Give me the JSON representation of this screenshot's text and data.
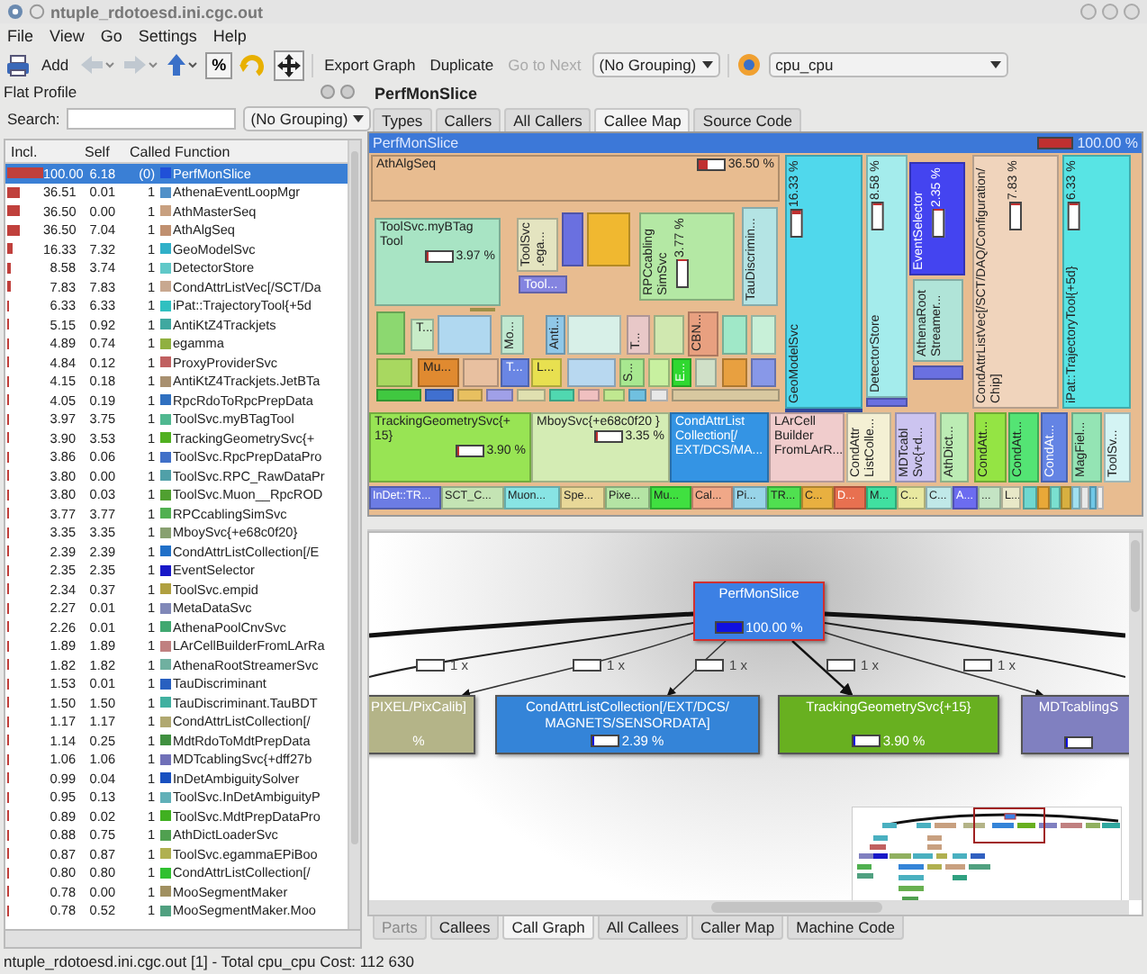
{
  "window": {
    "title": "ntuple_rdotoesd.ini.cgc.out"
  },
  "menu": [
    "File",
    "View",
    "Go",
    "Settings",
    "Help"
  ],
  "toolbar": {
    "add": "Add",
    "percent_toggle": {
      "label": "%",
      "checked": true
    },
    "move_toggle": {
      "checked": true
    },
    "export": "Export Graph",
    "duplicate": "Duplicate",
    "go_next": {
      "label": "Go to Next",
      "disabled": true
    },
    "grouping": "(No Grouping)",
    "event_type": "cpu_cpu"
  },
  "flat_profile": {
    "title": "Flat Profile",
    "search_label": "Search:",
    "grouping": "(No Grouping)",
    "columns": [
      "Incl.",
      "Self",
      "Called",
      "Function"
    ],
    "rows": [
      {
        "incl": "100.00",
        "self": "6.18",
        "called": "(0)",
        "function": "PerfMonSlice",
        "color": "#2050d8",
        "level": 1,
        "selected": true
      },
      {
        "incl": "36.51",
        "self": "0.01",
        "called": "1",
        "function": "AthenaEventLoopMgr",
        "color": "#5090c8",
        "level": 0.3651,
        "selected": false
      },
      {
        "incl": "36.50",
        "self": "0.00",
        "called": "1",
        "function": "AthMasterSeq",
        "color": "#c8a080",
        "level": 0.365,
        "selected": false
      },
      {
        "incl": "36.50",
        "self": "7.04",
        "called": "1",
        "function": "AthAlgSeq",
        "color": "#c09070",
        "level": 0.365,
        "selected": false
      },
      {
        "incl": "16.33",
        "self": "7.32",
        "called": "1",
        "function": "GeoModelSvc",
        "color": "#30b0c8",
        "level": 0.1633,
        "selected": false
      },
      {
        "incl": "8.58",
        "self": "3.74",
        "called": "1",
        "function": "DetectorStore",
        "color": "#60c8c8",
        "level": 0.0858,
        "selected": false
      },
      {
        "incl": "7.83",
        "self": "7.83",
        "called": "1",
        "function": "CondAttrListVec[/SCT/Da",
        "color": "#c8a890",
        "level": 0.0783,
        "selected": false
      },
      {
        "incl": "6.33",
        "self": "6.33",
        "called": "1",
        "function": "iPat::TrajectoryTool{+5d",
        "color": "#30c0c0",
        "level": 0.0633,
        "selected": false
      },
      {
        "incl": "5.15",
        "self": "0.92",
        "called": "1",
        "function": "AntiKtZ4Trackjets",
        "color": "#40a8a0",
        "level": 0.0515,
        "selected": false
      },
      {
        "incl": "4.89",
        "self": "0.74",
        "called": "1",
        "function": "egamma",
        "color": "#90b040",
        "level": 0.0489,
        "selected": false
      },
      {
        "incl": "4.84",
        "self": "0.12",
        "called": "1",
        "function": "ProxyProviderSvc",
        "color": "#c06060",
        "level": 0.0484,
        "selected": false
      },
      {
        "incl": "4.15",
        "self": "0.18",
        "called": "1",
        "function": "AntiKtZ4Trackjets.JetBTa",
        "color": "#a89070",
        "level": 0.0415,
        "selected": false
      },
      {
        "incl": "4.05",
        "self": "0.19",
        "called": "1",
        "function": "RpcRdoToRpcPrepData",
        "color": "#3070c0",
        "level": 0.0405,
        "selected": false
      },
      {
        "incl": "3.97",
        "self": "3.75",
        "called": "1",
        "function": "ToolSvc.myBTagTool",
        "color": "#50b890",
        "level": 0.0397,
        "selected": false
      },
      {
        "incl": "3.90",
        "self": "3.53",
        "called": "1",
        "function": "TrackingGeometrySvc{+",
        "color": "#50b020",
        "level": 0.039,
        "selected": false
      },
      {
        "incl": "3.86",
        "self": "0.06",
        "called": "1",
        "function": "ToolSvc.RpcPrepDataPro",
        "color": "#4070c8",
        "level": 0.0386,
        "selected": false
      },
      {
        "incl": "3.80",
        "self": "0.00",
        "called": "1",
        "function": "ToolSvc.RPC_RawDataPr",
        "color": "#50a0a8",
        "level": 0.038,
        "selected": false
      },
      {
        "incl": "3.80",
        "self": "0.03",
        "called": "1",
        "function": "ToolSvc.Muon__RpcROD",
        "color": "#50a030",
        "level": 0.038,
        "selected": false
      },
      {
        "incl": "3.77",
        "self": "3.77",
        "called": "1",
        "function": "RPCcablingSimSvc",
        "color": "#50b050",
        "level": 0.0377,
        "selected": false
      },
      {
        "incl": "3.35",
        "self": "3.35",
        "called": "1",
        "function": "MboySvc{+e68c0f20}",
        "color": "#88a070",
        "level": 0.0335,
        "selected": false
      },
      {
        "incl": "2.39",
        "self": "2.39",
        "called": "1",
        "function": "CondAttrListCollection[/E",
        "color": "#2070c8",
        "level": 0.0239,
        "selected": false
      },
      {
        "incl": "2.35",
        "self": "2.35",
        "called": "1",
        "function": "EventSelector",
        "color": "#1818c8",
        "level": 0.0235,
        "selected": false
      },
      {
        "incl": "2.34",
        "self": "0.37",
        "called": "1",
        "function": "ToolSvc.empid",
        "color": "#b0a040",
        "level": 0.0234,
        "selected": false
      },
      {
        "incl": "2.27",
        "self": "0.01",
        "called": "1",
        "function": "MetaDataSvc",
        "color": "#8088b8",
        "level": 0.0227,
        "selected": false
      },
      {
        "incl": "2.26",
        "self": "0.01",
        "called": "1",
        "function": "AthenaPoolCnvSvc",
        "color": "#40a870",
        "level": 0.0226,
        "selected": false
      },
      {
        "incl": "1.89",
        "self": "1.89",
        "called": "1",
        "function": "LArCellBuilderFromLArRa",
        "color": "#c08080",
        "level": 0.0189,
        "selected": false
      },
      {
        "incl": "1.82",
        "self": "1.82",
        "called": "1",
        "function": "AthenaRootStreamerSvc",
        "color": "#70b0a0",
        "level": 0.0182,
        "selected": false
      },
      {
        "incl": "1.53",
        "self": "0.01",
        "called": "1",
        "function": "TauDiscriminant",
        "color": "#2860c0",
        "level": 0.0153,
        "selected": false
      },
      {
        "incl": "1.50",
        "self": "1.50",
        "called": "1",
        "function": "TauDiscriminant.TauBDT",
        "color": "#40b0a0",
        "level": 0.015,
        "selected": false
      },
      {
        "incl": "1.17",
        "self": "1.17",
        "called": "1",
        "function": "CondAttrListCollection[/",
        "color": "#b0a870",
        "level": 0.0117,
        "selected": false
      },
      {
        "incl": "1.14",
        "self": "0.25",
        "called": "1",
        "function": "MdtRdoToMdtPrepData",
        "color": "#409040",
        "level": 0.0114,
        "selected": false
      },
      {
        "incl": "1.06",
        "self": "1.06",
        "called": "1",
        "function": "MDTcablingSvc{+dff27b",
        "color": "#7070b8",
        "level": 0.0106,
        "selected": false
      },
      {
        "incl": "0.99",
        "self": "0.04",
        "called": "1",
        "function": "InDetAmbiguitySolver",
        "color": "#1850c0",
        "level": 0.0099,
        "selected": false
      },
      {
        "incl": "0.95",
        "self": "0.13",
        "called": "1",
        "function": "ToolSvc.InDetAmbiguityP",
        "color": "#60b0b8",
        "level": 0.0095,
        "selected": false
      },
      {
        "incl": "0.89",
        "self": "0.02",
        "called": "1",
        "function": "ToolSvc.MdtPrepDataPro",
        "color": "#40b020",
        "level": 0.0089,
        "selected": false
      },
      {
        "incl": "0.88",
        "self": "0.75",
        "called": "1",
        "function": "AthDictLoaderSvc",
        "color": "#50a050",
        "level": 0.0088,
        "selected": false
      },
      {
        "incl": "0.87",
        "self": "0.87",
        "called": "1",
        "function": "ToolSvc.egammaEPiBoo",
        "color": "#b0b050",
        "level": 0.0087,
        "selected": false
      },
      {
        "incl": "0.80",
        "self": "0.80",
        "called": "1",
        "function": "CondAttrListCollection[/",
        "color": "#30c030",
        "level": 0.008,
        "selected": false
      },
      {
        "incl": "0.78",
        "self": "0.00",
        "called": "1",
        "function": "MooSegmentMaker",
        "color": "#a09060",
        "level": 0.0078,
        "selected": false
      },
      {
        "incl": "0.78",
        "self": "0.52",
        "called": "1",
        "function": "MooSegmentMaker.Moo",
        "color": "#50a080",
        "level": 0.0078,
        "selected": false
      }
    ]
  },
  "details": {
    "title": "PerfMonSlice",
    "top_tabs": [
      {
        "label": "Types",
        "selected": false
      },
      {
        "label": "Callers",
        "selected": false
      },
      {
        "label": "All Callers",
        "selected": false
      },
      {
        "label": "Callee Map",
        "selected": true
      },
      {
        "label": "Source Code",
        "selected": false
      }
    ],
    "treemap": {
      "root": {
        "label": "PerfMonSlice",
        "percent": "100.00 %",
        "level": 1
      },
      "tiles": [
        {
          "label": "AthAlgSeq",
          "percent": "36.50 %",
          "level": 0.365,
          "color": "#e8bc90",
          "kind": "horizontal"
        },
        {
          "label": "ToolSvc.myBTag Tool",
          "percent": "3.97 %",
          "level": 0.04,
          "color": "#a8e4c4",
          "kind": "horizontal"
        },
        {
          "label": "ToolSvc .ega...",
          "color": "#e4e4c0",
          "kind": "vertical"
        },
        {
          "label": "Tool...",
          "color": "#8484e0",
          "kind": "horizontal"
        },
        {
          "label": "RPCcabling SimSvc",
          "percent": "3.77 %",
          "level": 0.038,
          "color": "#b4e8a4",
          "kind": "vertical"
        },
        {
          "label": "TauDiscrimin...",
          "color": "#b4e4e4",
          "kind": "vertical"
        },
        {
          "label": "T...",
          "color": "#c8ecc8",
          "kind": "horizontal"
        },
        {
          "label": "Mo...",
          "color": "#c0e8d0",
          "kind": "vertical"
        },
        {
          "label": "Anti...",
          "color": "#90c8e8",
          "kind": "vertical"
        },
        {
          "label": "T...",
          "color": "#e8c8c8",
          "kind": "vertical"
        },
        {
          "label": "CBN...",
          "color": "#e8a080",
          "kind": "vertical"
        },
        {
          "label": "Mu...",
          "color": "#e08a30",
          "kind": "horizontal"
        },
        {
          "label": "T...",
          "color": "#6a86e4",
          "kind": "horizontal"
        },
        {
          "label": "L...",
          "color": "#e8e050",
          "kind": "horizontal"
        },
        {
          "label": "S...",
          "color": "#a8e890",
          "kind": "vertical"
        },
        {
          "label": "E...",
          "color": "#30d830",
          "kind": "vertical"
        },
        {
          "label": "GeoModelSvc",
          "percent": "16.33 %",
          "level": 0.163,
          "color": "#50d8ec",
          "kind": "vertical"
        },
        {
          "label": "DetectorStore",
          "percent": "8.58 %",
          "level": 0.086,
          "color": "#a4ecec",
          "kind": "vertical"
        },
        {
          "label": "EventSelector",
          "percent": "2.35 %",
          "level": 0.024,
          "color": "#4444f0",
          "kind": "vertical"
        },
        {
          "label": "AthenaRoot Streamer...",
          "color": "#b0e4d8",
          "kind": "vertical"
        },
        {
          "label": "CondAttrListVec[/SCT/DAQ/Configuration/ Chip]",
          "percent": "7.83 %",
          "level": 0.078,
          "color": "#f0d4bc",
          "kind": "vertical"
        },
        {
          "label": "iPat::TrajectoryTool{+5d}",
          "percent": "6.33 %",
          "level": 0.063,
          "color": "#58e4e4",
          "kind": "vertical"
        },
        {
          "label": "TrackingGeometrySvc{+ 15}",
          "percent": "3.90 %",
          "level": 0.039,
          "color": "#98e454",
          "kind": "horizontal"
        },
        {
          "label": "MboySvc{+e68c0f20 }",
          "percent": "3.35 %",
          "level": 0.034,
          "color": "#d4ecb4",
          "kind": "horizontal"
        },
        {
          "label": "CondAttrList Collection[/ EXT/DCS/MA...",
          "color": "#3494e4",
          "kind": "horizontal"
        },
        {
          "label": "LArCell Builder FromLArR...",
          "color": "#f0cccc",
          "kind": "horizontal"
        },
        {
          "label": "CondAttr ListColle...",
          "color": "#f4f0d4",
          "kind": "vertical"
        },
        {
          "label": "MDTcabl Svc{+d...",
          "color": "#ccc4f0",
          "kind": "vertical"
        },
        {
          "label": "AthDict...",
          "color": "#bcecb4",
          "kind": "vertical"
        },
        {
          "label": "CondAtt...",
          "color": "#94e444",
          "kind": "vertical"
        },
        {
          "label": "CondAtt...",
          "color": "#54e474",
          "kind": "vertical"
        },
        {
          "label": "CondAt...",
          "color": "#6484e4",
          "kind": "vertical"
        },
        {
          "label": "MagFiel...",
          "color": "#94e4b4",
          "kind": "vertical"
        },
        {
          "label": "ToolSv...",
          "color": "#d4f4f4",
          "kind": "vertical"
        }
      ],
      "strip": [
        {
          "label": "InDet::TR...",
          "color": "#6c7ce4"
        },
        {
          "label": "SCT_C...",
          "color": "#c4e4b4"
        },
        {
          "label": "Muon...",
          "color": "#88e4e4"
        },
        {
          "label": "Spe...",
          "color": "#e8d898"
        },
        {
          "label": "Pixe...",
          "color": "#b4e4a4"
        },
        {
          "label": "Mu...",
          "color": "#40e040"
        },
        {
          "label": "Cal...",
          "color": "#f0a888"
        },
        {
          "label": "Pi...",
          "color": "#98d4e8"
        },
        {
          "label": "TR...",
          "color": "#50e050"
        },
        {
          "label": "C...",
          "color": "#e8b040"
        },
        {
          "label": "D...",
          "color": "#e87050"
        },
        {
          "label": "M...",
          "color": "#40e0a0"
        },
        {
          "label": "C...",
          "color": "#e8e8a0"
        },
        {
          "label": "C...",
          "color": "#c0e8e8"
        },
        {
          "label": "A...",
          "color": "#6c6cf0"
        },
        {
          "label": "...",
          "color": "#c4e4c4"
        },
        {
          "label": "L...",
          "color": "#e8e8c8"
        }
      ]
    },
    "graph": {
      "nodes": [
        {
          "label": "PerfMonSlice",
          "percent": "100.00 %",
          "level": 1,
          "color": "#3c80e4",
          "selected": true
        },
        {
          "label": "PIXEL/PixCalib]",
          "percent": "%",
          "color": "#b4b488",
          "selected": false
        },
        {
          "label": "CondAttrListCollection[/EXT/DCS/ MAGNETS/SENSORDATA]",
          "percent": "2.39 %",
          "level": 0.024,
          "color": "#3484d8",
          "selected": false
        },
        {
          "label": "TrackingGeometrySvc{+15}",
          "percent": "3.90 %",
          "level": 0.039,
          "color": "#68b020",
          "selected": false
        },
        {
          "label": "MDTcablingS",
          "level": 0.01,
          "color": "#8080c0",
          "selected": false
        }
      ],
      "edges": [
        {
          "label": "1 x"
        },
        {
          "label": "1 x"
        },
        {
          "label": "1 x"
        },
        {
          "label": "1 x"
        },
        {
          "label": "1 x"
        }
      ]
    },
    "bottom_tabs": [
      {
        "label": "Parts",
        "selected": false,
        "disabled": true
      },
      {
        "label": "Callees",
        "selected": false,
        "disabled": false
      },
      {
        "label": "Call Graph",
        "selected": true,
        "disabled": false
      },
      {
        "label": "All Callees",
        "selected": false,
        "disabled": false
      },
      {
        "label": "Caller Map",
        "selected": false,
        "disabled": false
      },
      {
        "label": "Machine Code",
        "selected": false,
        "disabled": false
      }
    ]
  },
  "status_bar": "ntuple_rdotoesd.ini.cgc.out [1] - Total cpu_cpu Cost:  112 630"
}
